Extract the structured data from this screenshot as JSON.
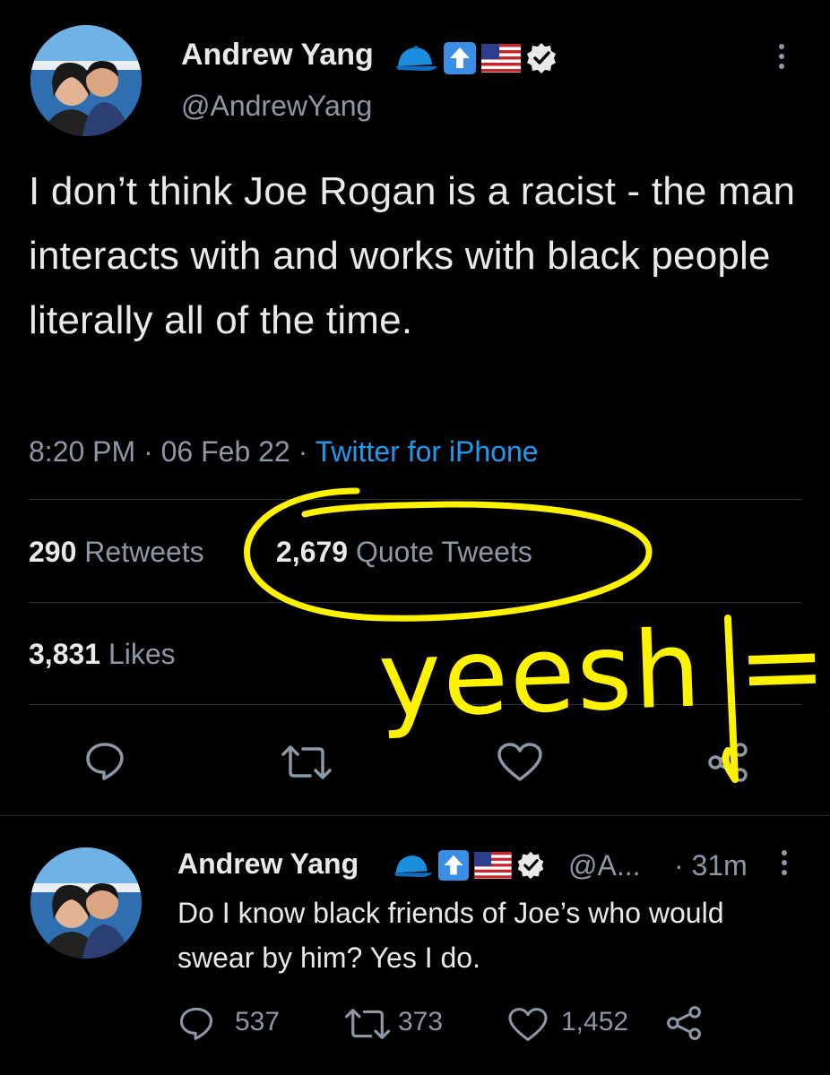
{
  "main_tweet": {
    "author_name": "Andrew Yang",
    "author_handle": "@AndrewYang",
    "text": "I don’t think Joe Rogan is a racist - the man interacts with and works with black people literally all of the time.",
    "time": "8:20 PM",
    "date": "06 Feb 22",
    "separator": "·",
    "source": "Twitter for iPhone",
    "retweets_count": "290",
    "retweets_label": "Retweets",
    "quotes_count": "2,679",
    "quotes_label": "Quote Tweets",
    "likes_count": "3,831",
    "likes_label": "Likes"
  },
  "annotation": {
    "text": "yeesh =/",
    "color": "#fff200"
  },
  "reply_tweet": {
    "author_name": "Andrew Yang",
    "author_handle": "@A...",
    "time": "· 31m",
    "text": "Do I know black friends of Joe’s who would swear by him? Yes I do.",
    "replies": "537",
    "retweets": "373",
    "likes": "1,452"
  },
  "colors": {
    "background": "#000000",
    "text": "#e7e9ea",
    "secondary": "#8b98a5",
    "link": "#1d9bf0",
    "divider": "#2f3336"
  },
  "icons": {
    "badges": [
      "blue-cap-icon",
      "up-arrow-icon",
      "us-flag-icon",
      "verified-icon"
    ],
    "actions": [
      "reply-icon",
      "retweet-icon",
      "like-icon",
      "share-icon"
    ]
  }
}
